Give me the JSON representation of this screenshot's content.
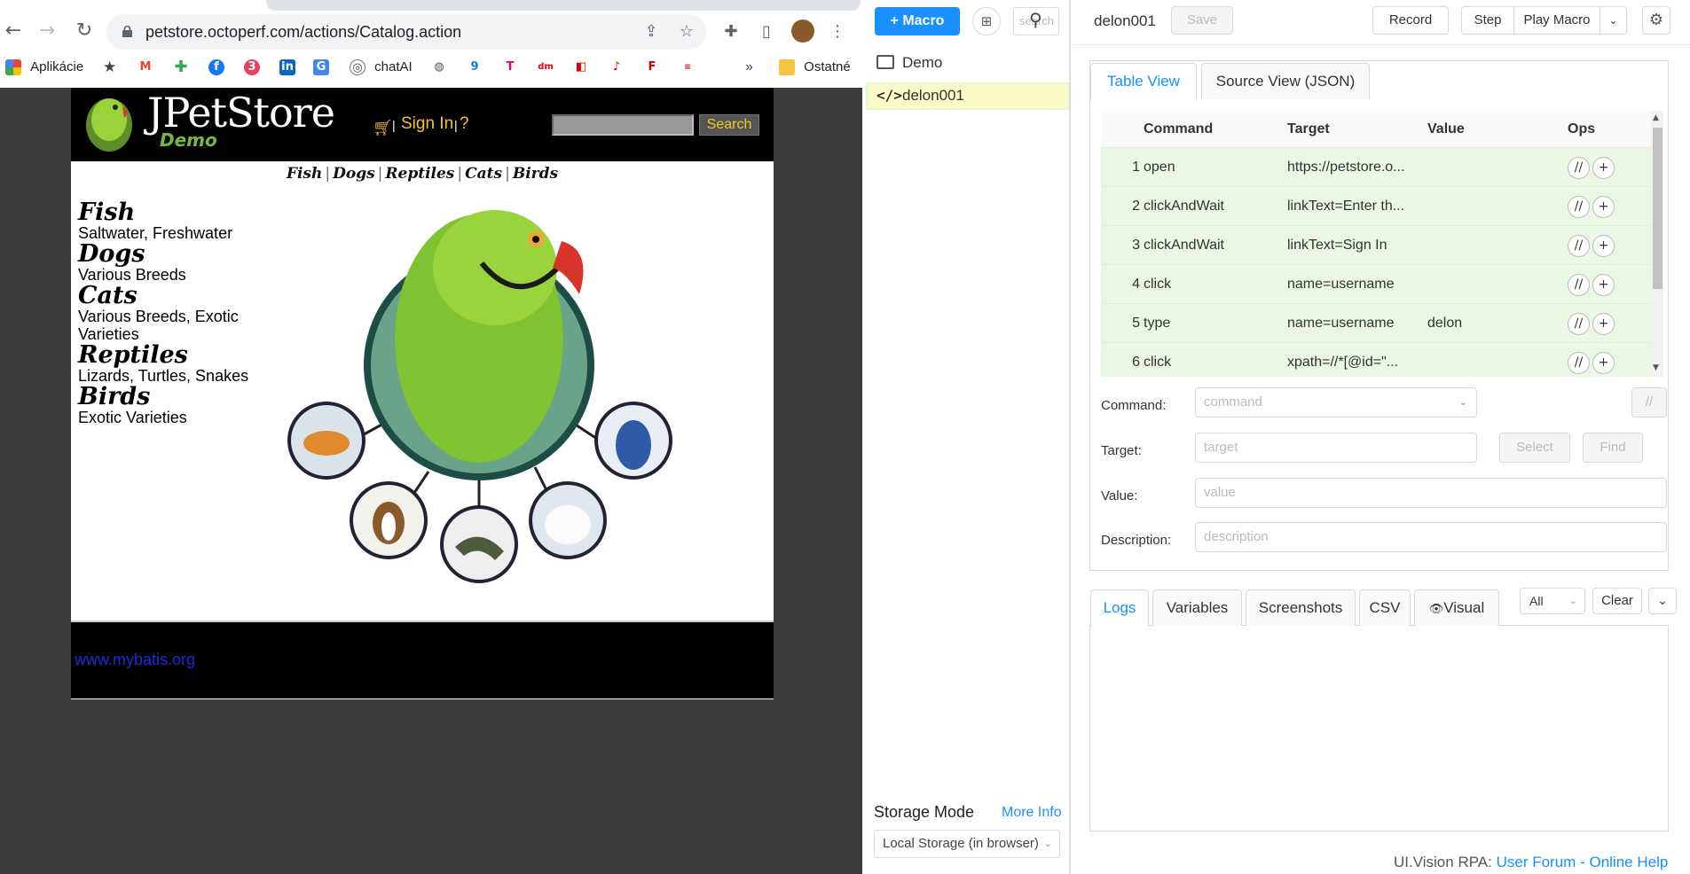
{
  "browser": {
    "url": "petstore.octoperf.com/actions/Catalog.action",
    "bookmarks": [
      "Aplikácie",
      "chatAI",
      "Ostatné"
    ],
    "overflow": "»"
  },
  "petstore": {
    "logo": "JPetStore",
    "logo_sub": "Demo",
    "sign_in": "Sign In",
    "help": "?",
    "search_button": "Search",
    "quicklinks": [
      "Fish",
      "Dogs",
      "Reptiles",
      "Cats",
      "Birds"
    ],
    "categories": [
      {
        "name": "Fish",
        "desc": "Saltwater, Freshwater"
      },
      {
        "name": "Dogs",
        "desc": "Various Breeds"
      },
      {
        "name": "Cats",
        "desc": "Various Breeds, Exotic Varieties"
      },
      {
        "name": "Reptiles",
        "desc": "Lizards, Turtles, Snakes"
      },
      {
        "name": "Birds",
        "desc": "Exotic Varieties"
      }
    ],
    "footer_link": "www.mybatis.org"
  },
  "uivision": {
    "new_macro": "+ Macro",
    "search_placeholder": "search",
    "tree": {
      "folder": "Demo",
      "macro": "delon001"
    },
    "storage_mode_label": "Storage Mode",
    "more_info": "More Info",
    "storage_mode_value": "Local Storage (in browser)",
    "macro_title": "delon001",
    "save": "Save",
    "record": "Record",
    "step": "Step",
    "play_macro": "Play Macro",
    "tabs": {
      "table": "Table View",
      "source": "Source View (JSON)"
    },
    "table_headers": {
      "command": "Command",
      "target": "Target",
      "value": "Value",
      "ops": "Ops"
    },
    "rows": [
      {
        "idx": "1",
        "command": "open",
        "target": "https://petstore.o...",
        "value": ""
      },
      {
        "idx": "2",
        "command": "clickAndWait",
        "target": "linkText=Enter th...",
        "value": ""
      },
      {
        "idx": "3",
        "command": "clickAndWait",
        "target": "linkText=Sign In",
        "value": ""
      },
      {
        "idx": "4",
        "command": "click",
        "target": "name=username",
        "value": ""
      },
      {
        "idx": "5",
        "command": "type",
        "target": "name=username",
        "value": "delon"
      },
      {
        "idx": "6",
        "command": "click",
        "target": "xpath=//*[@id=\"...",
        "value": ""
      }
    ],
    "op_comment": "//",
    "op_add": "+",
    "form": {
      "command_label": "Command",
      "command_placeholder": "command",
      "target_label": "Target",
      "target_placeholder": "target",
      "select": "Select",
      "find": "Find",
      "value_label": "Value",
      "value_placeholder": "value",
      "description_label": "Description",
      "description_placeholder": "description"
    },
    "log_tabs": [
      "Logs",
      "Variables",
      "Screenshots",
      "CSV",
      "Visual"
    ],
    "log_filter": "All",
    "clear": "Clear",
    "footer": {
      "brand": "UI.Vision RPA:",
      "forum": "User Forum",
      "dash": "-",
      "help": "Online Help"
    }
  },
  "colors": {
    "accent": "#1890ff",
    "row_green": "#e9f7e4",
    "selected": "#fbfbc7",
    "petstore_gold": "#f7c521"
  }
}
